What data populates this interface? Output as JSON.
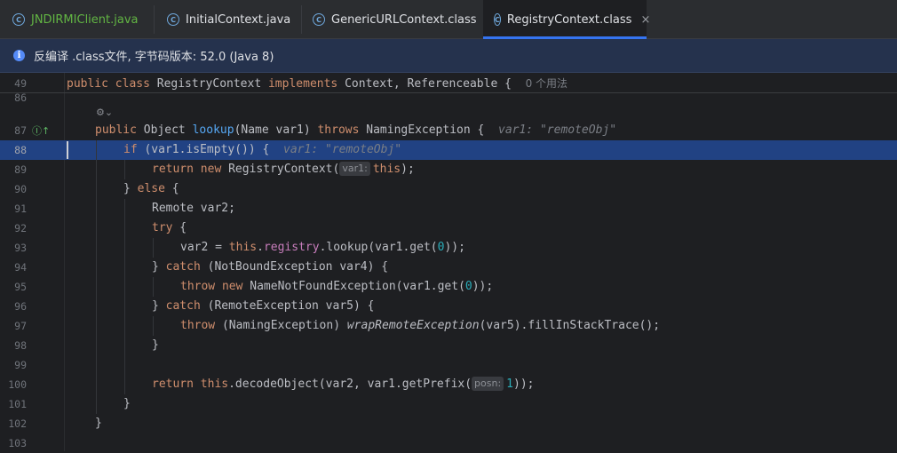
{
  "tabs": [
    {
      "label": "JNDIRMIClient.java",
      "icon": "java-class-icon",
      "modified": true
    },
    {
      "label": "InitialContext.java",
      "icon": "java-class-icon"
    },
    {
      "label": "GenericURLContext.class",
      "icon": "java-class-icon"
    },
    {
      "label": "RegistryContext.class",
      "icon": "java-class-icon",
      "active": true,
      "close": "×"
    }
  ],
  "banner": {
    "text": "反编译 .class文件, 字节码版本: 52.0 (Java 8)",
    "icon": "info-icon"
  },
  "header_line": {
    "num": "49",
    "kw1": "public class",
    "name": "RegistryContext",
    "kw2": "implements",
    "rest": "Context, Referenceable {",
    "usages": "0 个用法"
  },
  "lines": [
    {
      "num": "86"
    },
    {
      "num": "87"
    },
    {
      "num": "88"
    },
    {
      "num": "89"
    },
    {
      "num": "90"
    },
    {
      "num": "91"
    },
    {
      "num": "92"
    },
    {
      "num": "93"
    },
    {
      "num": "94"
    },
    {
      "num": "95"
    },
    {
      "num": "96"
    },
    {
      "num": "97"
    },
    {
      "num": "98"
    },
    {
      "num": "99"
    },
    {
      "num": "100"
    },
    {
      "num": "101"
    },
    {
      "num": "102"
    },
    {
      "num": "103"
    }
  ],
  "code": {
    "l87": {
      "kw": "public",
      "t1": " Object ",
      "fn": "lookup",
      "t2": "(Name var1) ",
      "kw2": "throws",
      "t3": " NamingException {",
      "hint": "var1: \"remoteObj\""
    },
    "l88": {
      "kw": "if",
      "t1": " (var1.isEmpty()) {",
      "hint": "var1: \"remoteObj\""
    },
    "l89": {
      "kw": "return new",
      "t1": " RegistryContext(",
      "inlay": "var1:",
      "kw2": "this",
      "t2": ");"
    },
    "l90": {
      "t1": "} ",
      "kw": "else",
      "t2": " {"
    },
    "l91": {
      "t1": "Remote var2;"
    },
    "l92": {
      "kw": "try",
      "t1": " {"
    },
    "l93": {
      "t1": "var2 = ",
      "kw": "this",
      "t2": ".",
      "fld": "registry",
      "t3": ".lookup(var1.get(",
      "num": "0",
      "t4": "));"
    },
    "l94": {
      "t1": "} ",
      "kw": "catch",
      "t2": " (NotBoundException var4) {"
    },
    "l95": {
      "kw": "throw new",
      "t1": " NameNotFoundException(var1.get(",
      "num": "0",
      "t2": "));"
    },
    "l96": {
      "t1": "} ",
      "kw": "catch",
      "t2": " (RemoteException var5) {"
    },
    "l97": {
      "kw": "throw",
      "t1": " (NamingException) ",
      "it": "wrapRemoteException",
      "t2": "(var5).fillInStackTrace();"
    },
    "l98": {
      "t1": "}"
    },
    "l100": {
      "kw": "return",
      "t1": " ",
      "kw2": "this",
      "t2": ".decodeObject(var2, var1.getPrefix(",
      "inlay": "posn:",
      "num": "1",
      "t3": "));"
    },
    "l101": {
      "t1": "}"
    },
    "l102": {
      "t1": "}"
    }
  },
  "gutter_icon": "Ⓘ↑",
  "fold_icon": "⚙⌄"
}
